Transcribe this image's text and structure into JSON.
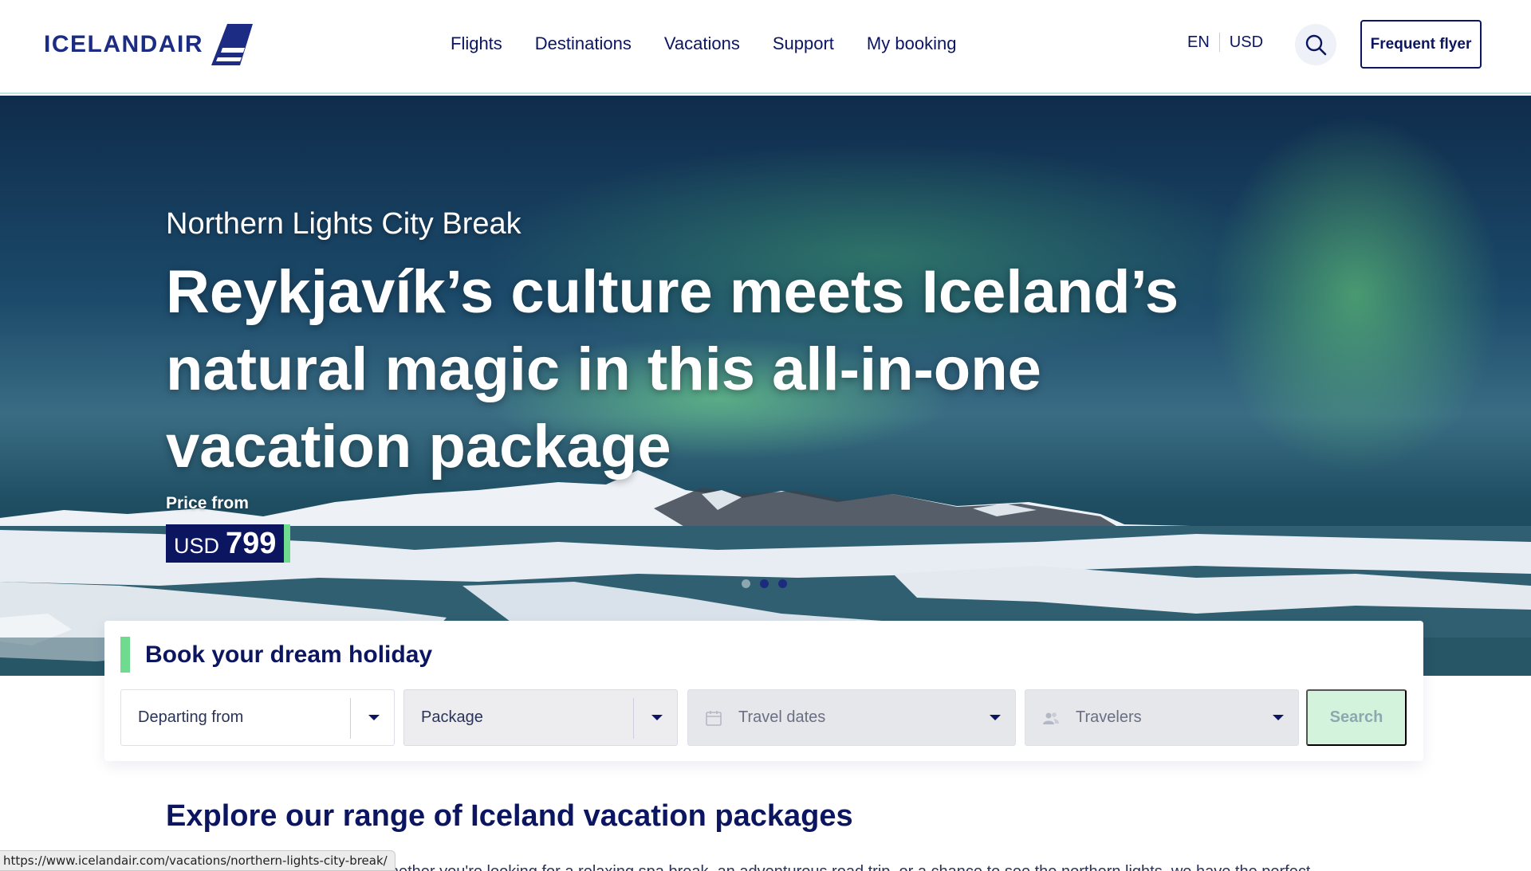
{
  "header": {
    "logo_text": "ICELANDAIR",
    "nav": [
      "Flights",
      "Destinations",
      "Vacations",
      "Support",
      "My booking"
    ],
    "language": "EN",
    "currency": "USD",
    "frequent_flyer": "Frequent flyer"
  },
  "hero": {
    "subtitle": "Northern Lights City Break",
    "title": "Reykjavík’s culture meets Iceland’s natural magic in this all-in-one vacation package",
    "price_label": "Price from",
    "price_currency": "USD",
    "price_value": "799",
    "carousel": {
      "count": 3,
      "active_index": 1
    }
  },
  "booking": {
    "title": "Book your dream holiday",
    "departing_from": "Departing from",
    "package": "Package",
    "travel_dates": "Travel dates",
    "travelers": "Travelers",
    "search": "Search"
  },
  "explore": {
    "heading": "Explore our range of Iceland vacation packages",
    "description": "Whether you're looking for a relaxing spa break, an adventurous road trip, or a chance to see the northern lights, we have the perfect"
  },
  "status_bar": {
    "url": "https://www.icelandair.com/vacations/northern-lights-city-break/"
  },
  "colors": {
    "navy": "#0b1560",
    "accent_green": "#6fdb8f",
    "search_disabled_bg": "#d4f3dc"
  },
  "icons": {
    "logo": "icelandair-wing-logo",
    "search": "magnifier",
    "calendar": "calendar",
    "travelers": "people",
    "dropdown": "caret-down"
  }
}
